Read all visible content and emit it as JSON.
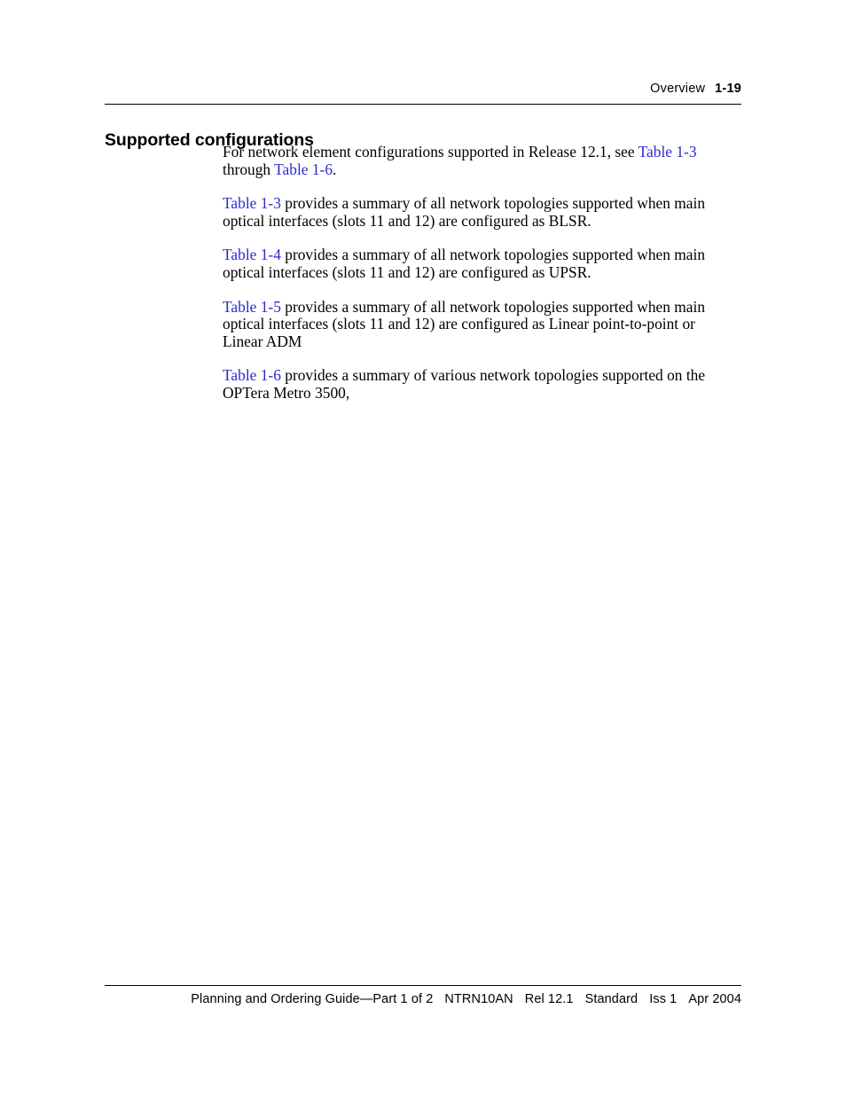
{
  "header": {
    "chapter": "Overview",
    "folio": "1-19"
  },
  "section": {
    "heading": "Supported configurations"
  },
  "paragraphs": {
    "p1": {
      "a": "For network element configurations supported in Release 12.1, see ",
      "link1": "Table 1-3",
      "b": " through ",
      "link2": "Table 1-6",
      "c": "."
    },
    "p2": {
      "link1": "Table 1-3",
      "a": " provides a summary of all network topologies supported when main optical interfaces (slots 11 and 12) are configured as BLSR."
    },
    "p3": {
      "link1": "Table 1-4",
      "a": " provides a summary of all network topologies supported when main optical interfaces (slots 11 and 12) are configured as UPSR."
    },
    "p4": {
      "link1": "Table 1-5",
      "a": " provides a summary of all network topologies supported when main optical interfaces (slots 11 and 12) are configured as Linear point-to-point or Linear ADM"
    },
    "p5": {
      "link1": "Table 1-6",
      "a": " provides a summary of various network topologies supported on the OPTera Metro 3500,"
    }
  },
  "footer": {
    "guide": "Planning and Ordering Guide—Part 1 of 2",
    "doc_number": "NTRN10AN",
    "release": "Rel 12.1",
    "status": "Standard",
    "issue": "Iss 1",
    "date": "Apr 2004"
  },
  "colors": {
    "text": "#000000",
    "xref_link": "#2a2ad0",
    "page_background": "#ffffff",
    "rule": "#000000"
  }
}
